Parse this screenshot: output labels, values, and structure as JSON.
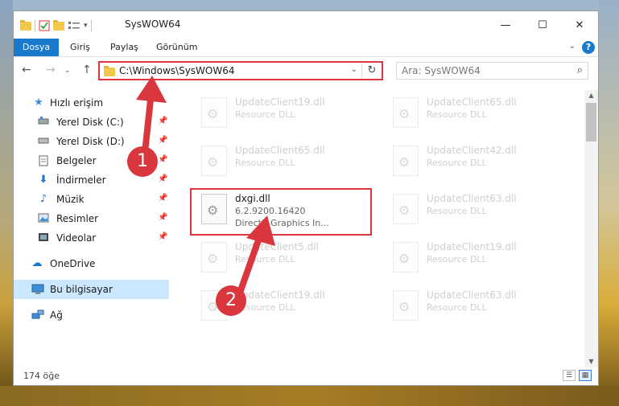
{
  "window": {
    "title": "SysWOW64",
    "minimize_glyph": "—",
    "maximize_glyph": "☐",
    "close_glyph": "✕"
  },
  "ribbon": {
    "tabs": [
      "Dosya",
      "Giriş",
      "Paylaş",
      "Görünüm"
    ],
    "help": "?"
  },
  "address": {
    "path": "C:\\Windows\\SysWOW64"
  },
  "search": {
    "placeholder": "Ara: SysWOW64"
  },
  "sidebar": {
    "items": [
      {
        "label": "Hızlı erişim",
        "icon": "star-icon"
      },
      {
        "label": "Yerel Disk (C:)",
        "icon": "drive-icon"
      },
      {
        "label": "Yerel Disk (D:)",
        "icon": "drive-icon"
      },
      {
        "label": "Belgeler",
        "icon": "documents-icon"
      },
      {
        "label": "İndirmeler",
        "icon": "download-icon"
      },
      {
        "label": "Müzik",
        "icon": "music-icon"
      },
      {
        "label": "Resimler",
        "icon": "pictures-icon"
      },
      {
        "label": "Videolar",
        "icon": "video-icon"
      },
      {
        "label": "OneDrive",
        "icon": "cloud-icon"
      },
      {
        "label": "Bu bilgisayar",
        "icon": "computer-icon"
      },
      {
        "label": "Ağ",
        "icon": "network-icon"
      }
    ]
  },
  "files": {
    "left": [
      {
        "name": "UpdateClient19.dll",
        "line1": "Resource DLL",
        "line2": ""
      },
      {
        "name": "UpdateClient65.dll",
        "line1": "Resource DLL",
        "line2": ""
      },
      {
        "name": "dxgi.dll",
        "line1": "6.2.9200.16420",
        "line2": "DirectX Graphics In..."
      },
      {
        "name": "UpdateClient5.dll",
        "line1": "Resource DLL",
        "line2": ""
      },
      {
        "name": "UpdateClient19.dll",
        "line1": "Resource DLL",
        "line2": ""
      }
    ],
    "right": [
      {
        "name": "UpdateClient65.dll",
        "line1": "Resource DLL"
      },
      {
        "name": "UpdateClient42.dll",
        "line1": "Resource DLL"
      },
      {
        "name": "UpdateClient63.dll",
        "line1": "Resource DLL"
      },
      {
        "name": "UpdateClient19.dll",
        "line1": "Resource DLL"
      },
      {
        "name": "UpdateClient63.dll",
        "line1": "Resource DLL"
      }
    ]
  },
  "status": {
    "count": "174 öğe"
  },
  "annotations": {
    "step1": "1",
    "step2": "2"
  },
  "colors": {
    "accent": "#1979ca",
    "highlight": "#d9363e",
    "selected": "#cce8ff"
  }
}
